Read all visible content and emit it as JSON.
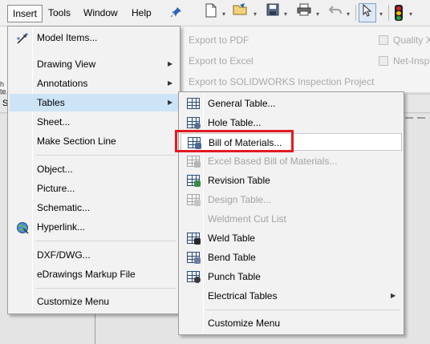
{
  "menubar": {
    "items": [
      "Insert",
      "Tools",
      "Window",
      "Help"
    ],
    "pin_icon": "pushpin-icon"
  },
  "toolbar": {
    "icons": [
      "new-document-icon",
      "open-folder-icon",
      "save-icon",
      "print-icon",
      "undo-icon",
      "select-pointer-icon",
      "traffic-light-icon"
    ]
  },
  "background": {
    "commands": [
      "Export to PDF",
      "Export to Excel",
      "Export to SOLIDWORKS Inspection Project",
      "Quality X",
      "Net-Insp"
    ],
    "left_tab_letters": [
      "h",
      "te",
      "r"
    ],
    "panel_label": "S"
  },
  "insert_menu": {
    "items": [
      {
        "label": "Model Items...",
        "icon": "model-items-icon",
        "submenu": false
      },
      {
        "label": "Drawing View",
        "icon": "",
        "submenu": true
      },
      {
        "label": "Annotations",
        "icon": "",
        "submenu": true
      },
      {
        "label": "Tables",
        "icon": "",
        "submenu": true,
        "highlighted": true
      },
      {
        "label": "Sheet...",
        "icon": "",
        "submenu": false
      },
      {
        "label": "Make Section Line",
        "icon": "",
        "submenu": false
      },
      {
        "label": "Object...",
        "icon": "",
        "submenu": false
      },
      {
        "label": "Picture...",
        "icon": "",
        "submenu": false
      },
      {
        "label": "Schematic...",
        "icon": "",
        "submenu": false
      },
      {
        "label": "Hyperlink...",
        "icon": "hyperlink-globe-icon",
        "submenu": false
      },
      {
        "label": "DXF/DWG...",
        "icon": "",
        "submenu": false
      },
      {
        "label": "eDrawings Markup File",
        "icon": "",
        "submenu": false
      },
      {
        "label": "Customize Menu",
        "icon": "",
        "submenu": false
      }
    ]
  },
  "tables_submenu": {
    "items": [
      {
        "label": "General Table...",
        "icon": "general-table-icon",
        "disabled": false
      },
      {
        "label": "Hole Table...",
        "icon": "hole-table-icon",
        "disabled": false
      },
      {
        "label": "Bill of Materials...",
        "icon": "bill-of-materials-icon",
        "disabled": false,
        "focused": true
      },
      {
        "label": "Excel Based Bill of Materials...",
        "icon": "excel-bom-icon",
        "disabled": true
      },
      {
        "label": "Revision Table",
        "icon": "revision-table-icon",
        "disabled": false
      },
      {
        "label": "Design Table...",
        "icon": "design-table-icon",
        "disabled": true
      },
      {
        "label": "Weldment Cut List",
        "icon": "",
        "disabled": true
      },
      {
        "label": "Weld Table",
        "icon": "weld-table-icon",
        "disabled": false
      },
      {
        "label": "Bend Table",
        "icon": "bend-table-icon",
        "disabled": false
      },
      {
        "label": "Punch Table",
        "icon": "punch-table-icon",
        "disabled": false
      },
      {
        "label": "Electrical Tables",
        "icon": "",
        "disabled": false,
        "submenu": true
      },
      {
        "label": "Customize Menu",
        "icon": "",
        "disabled": false
      }
    ]
  },
  "colors": {
    "highlight": "#cde4f7",
    "annotation_box": "#e21a23",
    "disabled_text": "#a3a3a3"
  }
}
